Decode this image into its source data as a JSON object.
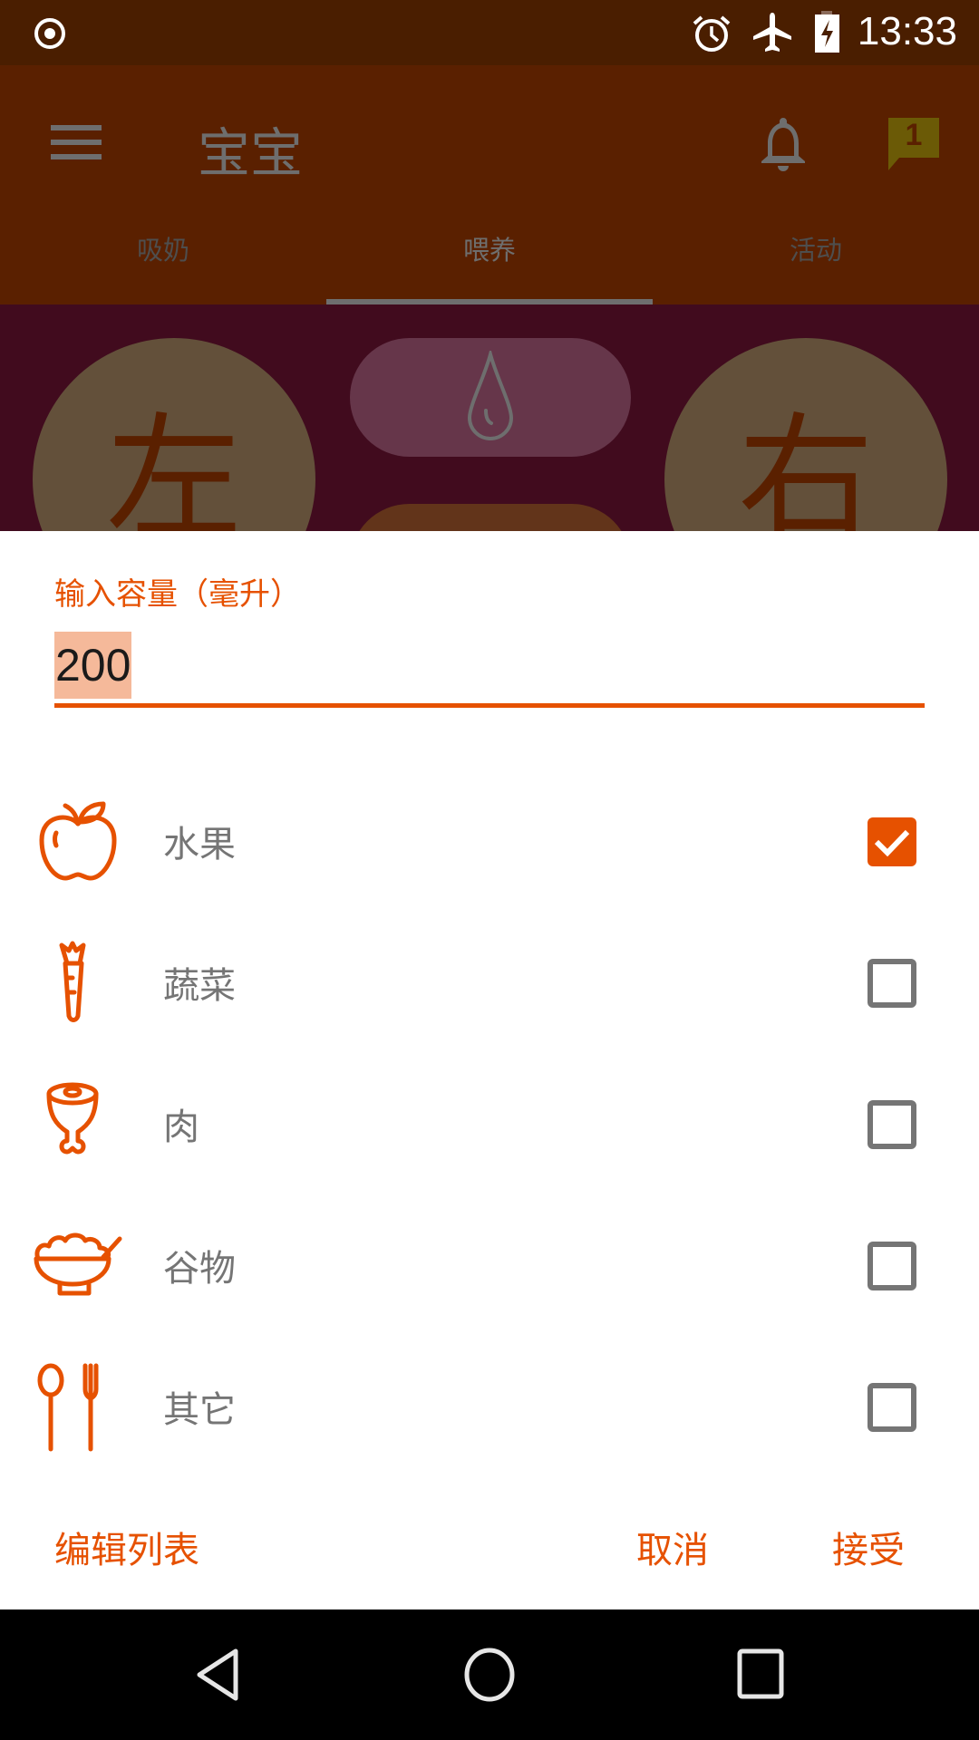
{
  "status_bar": {
    "time": "13:33",
    "left_icons": [
      "record-icon"
    ],
    "right_icons": [
      "alarm-icon",
      "airplane-mode-icon",
      "battery-charging-icon"
    ]
  },
  "app_bar": {
    "title": "宝宝",
    "notification_badge": "1"
  },
  "tabs": [
    {
      "label": "吸奶",
      "active": false
    },
    {
      "label": "喂养",
      "active": true
    },
    {
      "label": "活动",
      "active": false
    }
  ],
  "background_content": {
    "left_button": "左",
    "right_button": "右"
  },
  "dialog": {
    "field_label": "输入容量（毫升）",
    "field_value": "200",
    "items": [
      {
        "label": "水果",
        "icon": "apple-icon",
        "checked": true
      },
      {
        "label": "蔬菜",
        "icon": "carrot-icon",
        "checked": false
      },
      {
        "label": "肉",
        "icon": "meat-icon",
        "checked": false
      },
      {
        "label": "谷物",
        "icon": "rice-bowl-icon",
        "checked": false
      },
      {
        "label": "其它",
        "icon": "utensils-icon",
        "checked": false
      }
    ],
    "buttons": {
      "edit_list": "编辑列表",
      "cancel": "取消",
      "accept": "接受"
    }
  },
  "colors": {
    "accent": "#e65100",
    "status_bar": "#4a1e00",
    "app_bar": "#5a2000",
    "badge": "#6b5a06"
  }
}
